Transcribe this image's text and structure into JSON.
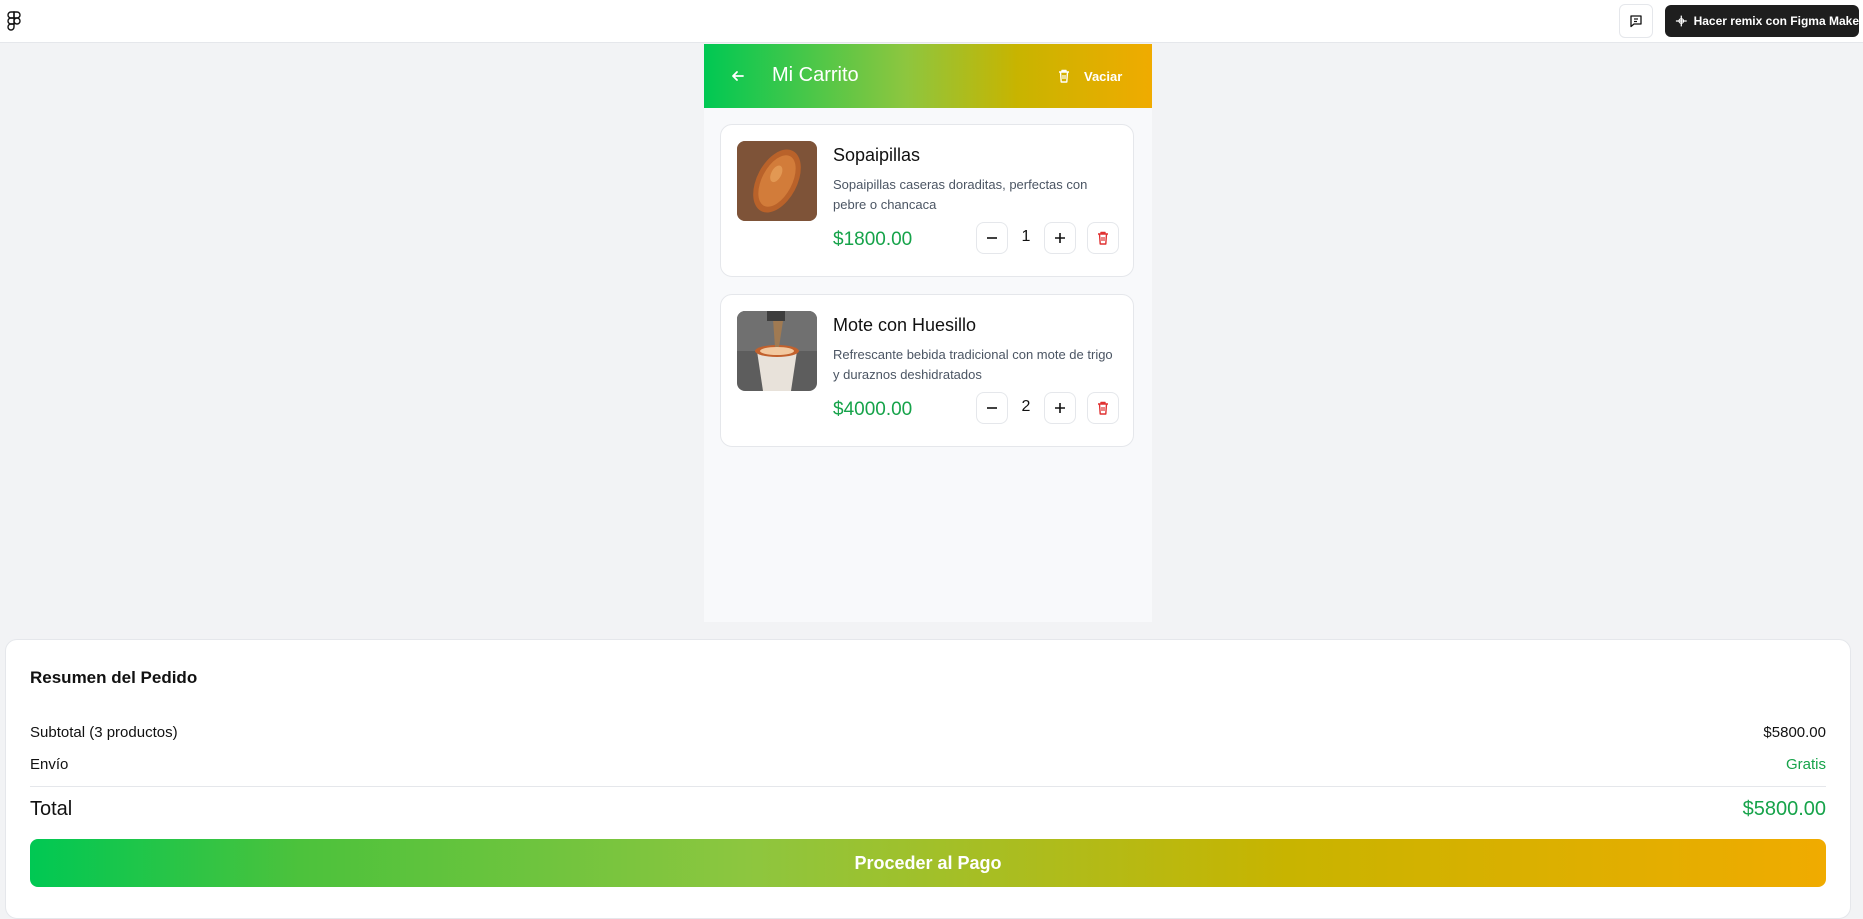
{
  "topbar": {
    "remix_label": "Hacer remix con Figma Make"
  },
  "header": {
    "title": "Mi Carrito",
    "clear_label": "Vaciar"
  },
  "colors": {
    "accent_green": "#16a34a",
    "gradient_start": "#00c853",
    "gradient_end": "#f0ab00",
    "delete_red": "#e03131"
  },
  "cart": {
    "items": [
      {
        "name": "Sopaipillas",
        "description": "Sopaipillas caseras doraditas, perfectas con pebre o chancaca",
        "price": "$1800.00",
        "quantity": "1"
      },
      {
        "name": "Mote con Huesillo",
        "description": "Refrescante bebida tradicional con mote de trigo y duraznos deshidratados",
        "price": "$4000.00",
        "quantity": "2"
      }
    ]
  },
  "summary": {
    "title": "Resumen del Pedido",
    "subtotal_label": "Subtotal (3 productos)",
    "subtotal_value": "$5800.00",
    "shipping_label": "Envío",
    "shipping_value": "Gratis",
    "total_label": "Total",
    "total_value": "$5800.00",
    "pay_label": "Proceder al Pago"
  }
}
